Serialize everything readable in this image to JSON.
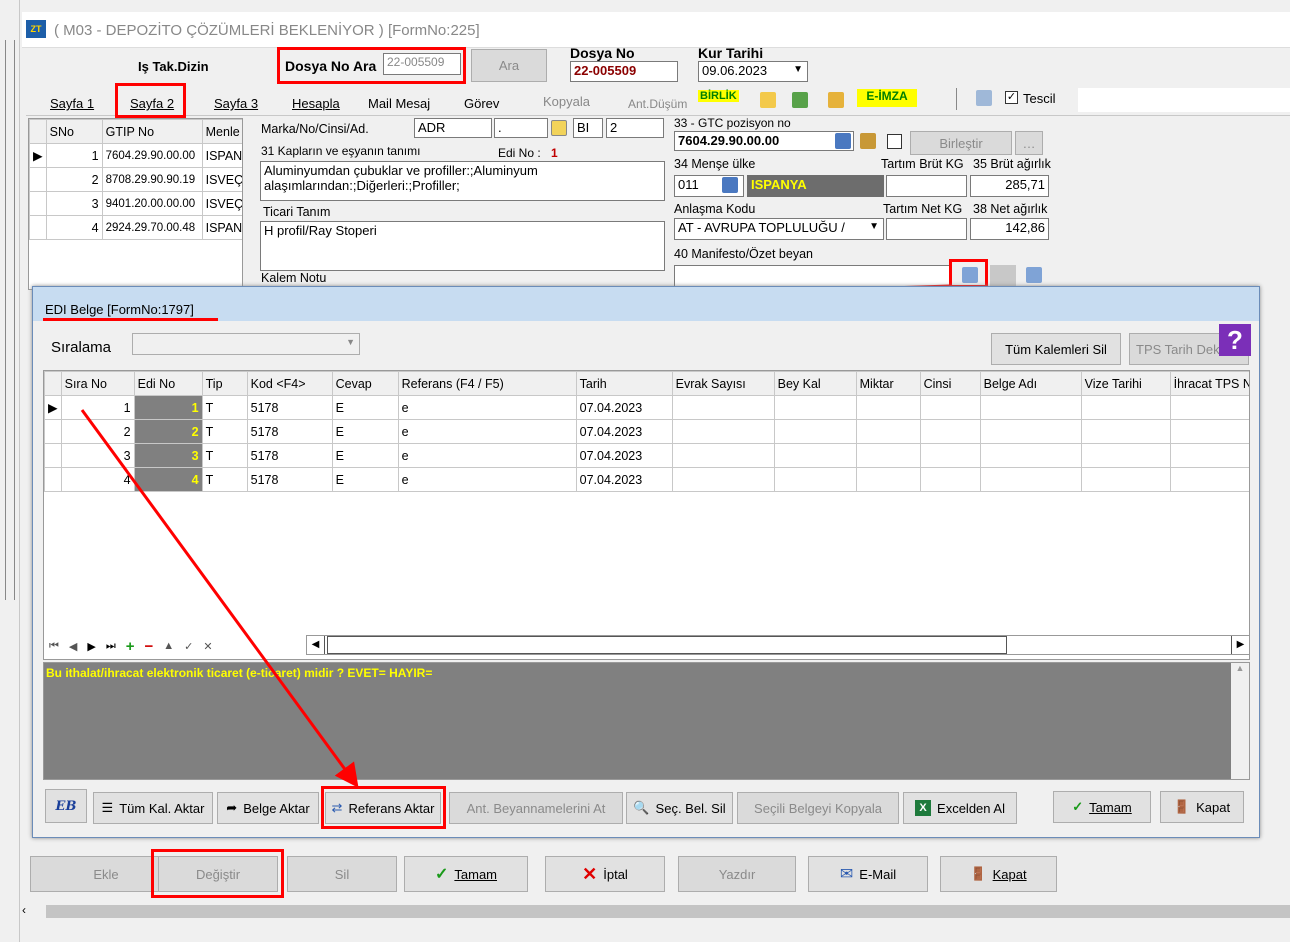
{
  "window": {
    "title": "( M03 - DEPOZİTO ÇÖZÜMLERİ BEKLENİYOR ) [FormNo:225]"
  },
  "header": {
    "left_label": "Iş Tak.Dizin",
    "search_label": "Dosya No Ara",
    "search_value": "22-005509",
    "search_button": "Ara",
    "dosya_no_label": "Dosya No",
    "dosya_no_value": "22-005509",
    "kur_tarihi_label": "Kur Tarihi",
    "kur_tarihi_value": "09.06.2023"
  },
  "tabs": [
    "Sayfa 1",
    "Sayfa 2",
    "Sayfa 3",
    "Hesapla",
    "Mail Mesaj",
    "Görev",
    "Kopyala",
    "Ant.Düşüm"
  ],
  "toolbar": {
    "birlik": "BİRLİK",
    "eimza": "E-İMZA",
    "tescil": "Tescil"
  },
  "item_grid": {
    "headers": [
      "SNo",
      "GTIP No",
      "Menle"
    ],
    "rows": [
      [
        "1",
        "7604.29.90.00.00",
        "ISPAN"
      ],
      [
        "2",
        "8708.29.90.90.19",
        "ISVEÇ"
      ],
      [
        "3",
        "9401.20.00.00.00",
        "ISVEÇ"
      ],
      [
        "4",
        "2924.29.70.00.48",
        "ISPAN"
      ]
    ]
  },
  "form": {
    "marka_label": "Marka/No/Cinsi/Ad.",
    "marka_value": "ADR",
    "marka_value2": ".",
    "bi_value": "BI",
    "num_value": "2",
    "kaplar_label": "31 Kapların ve eşyanın tanımı",
    "edi_no_label": "Edi No :",
    "edi_no_value": "1",
    "kaplar_text": "Aluminyumdan çubuklar ve profiller:;Aluminyum alaşımlarından:;Diğerleri:;Profiller;",
    "ticari_label": "Ticari Tanım",
    "ticari_text": "H profil/Ray Stoperi",
    "kalem_notu_label": "Kalem Notu",
    "gtc_label": "33 - GTC pozisyon no",
    "gtc_value": "7604.29.90.00.00",
    "birlestir": "Birleştir",
    "mense_label": "34 Menşe ülke",
    "mense_code": "011",
    "mense_country": "ISPANYA",
    "tartim_brut_label": "Tartım Brüt KG",
    "brut_label": "35 Brüt ağırlık",
    "brut_value": "285,71",
    "anlasma_label": "Anlaşma Kodu",
    "anlasma_value": "AT    - AVRUPA TOPLULUĞU / ",
    "tartim_net_label": "Tartım Net KG",
    "net_label": "38 Net ağırlık",
    "net_value": "142,86",
    "manifesto_label": "40 Manifesto/Özet beyan"
  },
  "dialog": {
    "title": "EDI Belge  [FormNo:1797]",
    "siralama_label": "Sıralama",
    "tum_kalemleri_sil": "Tüm Kalemleri Sil",
    "tps_button": "TPS Tarih Dek",
    "columns": [
      "Sıra No",
      "Edi No",
      "Tip",
      "Kod <F4>",
      "Cevap",
      "Referans (F4 / F5)",
      "Tarih",
      "Evrak Sayısı",
      "Bey Kal",
      "Miktar",
      "Cinsi",
      "Belge Adı",
      "Vize Tarihi",
      "İhracat TPS N"
    ],
    "rows": [
      [
        "1",
        "1",
        "T",
        "5178",
        "E",
        "e",
        "07.04.2023"
      ],
      [
        "2",
        "2",
        "T",
        "5178",
        "E",
        "e",
        "07.04.2023"
      ],
      [
        "3",
        "3",
        "T",
        "5178",
        "E",
        "e",
        "07.04.2023"
      ],
      [
        "4",
        "4",
        "T",
        "5178",
        "E",
        "e",
        "07.04.2023"
      ]
    ],
    "message": "Bu ithalat/ihracat elektronik ticaret (e-ticaret) midir ? EVET= HAYIR=",
    "buttons": {
      "tum_kal_aktar": "Tüm Kal. Aktar",
      "belge_aktar": "Belge Aktar",
      "referans_aktar": "Referans Aktar",
      "ant_beyan": "Ant. Beyannamelerini At",
      "sec_bel_sil": "Seç. Bel. Sil",
      "secili_kopyala": "Seçili Belgeyi Kopyala",
      "excelden_al": "Excelden Al",
      "tamam": "Tamam",
      "kapat": "Kapat"
    }
  },
  "bottom": {
    "ekle": "Ekle",
    "degistir": "Değiştir",
    "sil": "Sil",
    "tamam": "Tamam",
    "iptal": "İptal",
    "yazdir": "Yazdır",
    "email": "E-Mail",
    "kapat": "Kapat"
  },
  "colors": {
    "highlight": "#ff0000",
    "titlebar": "#1e2a8a",
    "dialog_title": "#c7dcf1",
    "message_bg": "#808080",
    "message_text": "#ffff00",
    "mense_bg": "#6d6d6d"
  }
}
